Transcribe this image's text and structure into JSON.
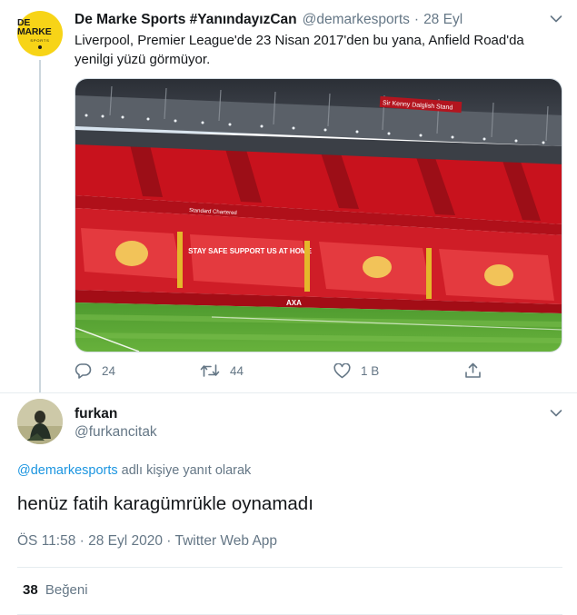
{
  "tweet": {
    "avatar_logo_text": "DE MARKE",
    "avatar_logo_subtext": "SPORTS",
    "author_name": "De Marke Sports #YanındayızCan",
    "author_handle": "@demarkesports",
    "separator": "·",
    "time": "28 Eyl",
    "text": "Liverpool, Premier League'de 23 Nisan 2017'den bu yana, Anfield Road'da yenilgi yüzü görmüyor.",
    "media": {
      "description_icon": "stadium-photo",
      "banner_text": "STAY SAFE SUPPORT US AT HOME",
      "sign_text": "Sir Kenny Dalglish Stand",
      "ad_text": "Standard Chartered",
      "sponsor_text": "AXA"
    },
    "actions": {
      "reply_count": "24",
      "retweet_count": "44",
      "like_count": "1 B"
    }
  },
  "reply": {
    "author_name": "furkan",
    "author_handle": "@furkancitak",
    "replying_to_mention": "@demarkesports",
    "replying_to_suffix": "adlı kişiye yanıt olarak",
    "text": "henüz fatih karagümrükle oynamadı",
    "meta": "ÖS 11:58 · 28 Eyl 2020 · Twitter Web App",
    "likes_count": "38",
    "likes_label": "Beğeni"
  },
  "colors": {
    "accent": "#1b95e0",
    "secondary_text": "#657786",
    "primary_text": "#14171a",
    "divider": "#e6ecf0",
    "avatar_yellow": "#f7d417"
  }
}
